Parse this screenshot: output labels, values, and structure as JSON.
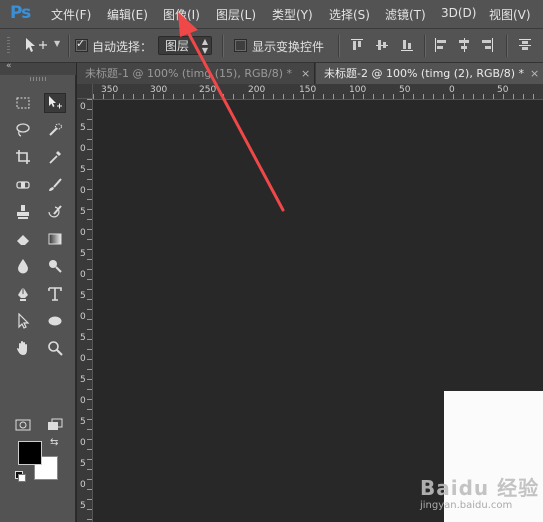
{
  "app": {
    "logo": "Ps"
  },
  "menu": {
    "items": [
      "文件(F)",
      "编辑(E)",
      "图像(I)",
      "图层(L)",
      "类型(Y)",
      "选择(S)",
      "滤镜(T)",
      "3D(D)",
      "视图(V)"
    ]
  },
  "options": {
    "auto_select_label": "自动选择：",
    "auto_select_checked": true,
    "auto_select_target": "图层",
    "show_transform_label": "显示变换控件",
    "show_transform_checked": false
  },
  "tabs": [
    {
      "label": "未标题-1 @ 100% (timg (15), RGB/8) *",
      "active": false
    },
    {
      "label": "未标题-2 @ 100% (timg (2), RGB/8) *",
      "active": true
    }
  ],
  "ruler": {
    "top_labels": [
      "350",
      "300",
      "250",
      "200",
      "150",
      "100",
      "50",
      "0",
      "50"
    ],
    "left_labels": [
      "0",
      "5",
      "0",
      "5",
      "0",
      "5",
      "0",
      "5",
      "0",
      "5",
      "0",
      "5",
      "0",
      "5",
      "0",
      "5",
      "0",
      "5",
      "0",
      "5"
    ]
  },
  "watermark": {
    "text": "Baidu 经验",
    "sub": "jingyan.baidu.com"
  },
  "colors": {
    "foreground": "#000000",
    "background": "#ffffff",
    "annotation_arrow": "#f04848",
    "ps_logo": "#3b8fd6"
  }
}
